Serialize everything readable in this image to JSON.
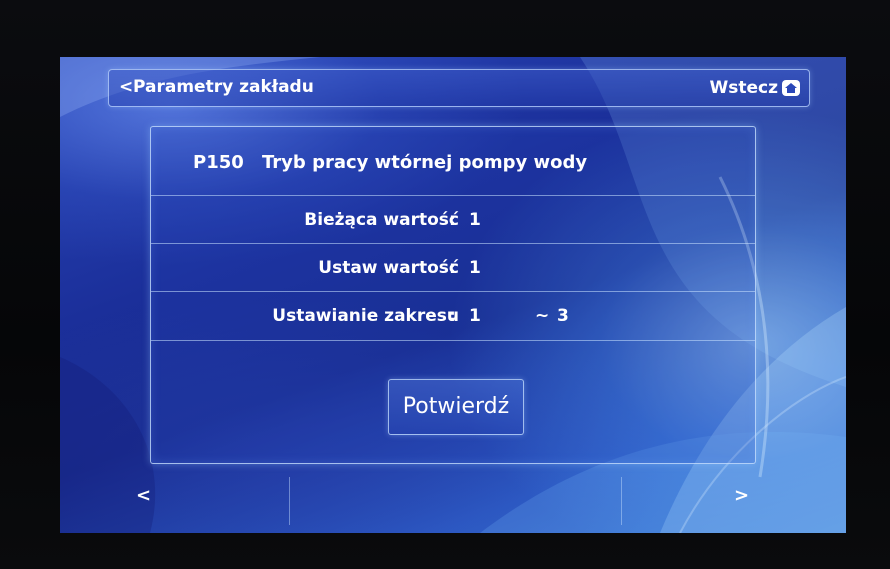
{
  "header": {
    "back_chevron": "<",
    "title": "Parametry zakładu",
    "back_label": "Wstecz",
    "home_icon": "home-icon"
  },
  "parameter": {
    "code": "P150",
    "name": "Tryb pracy wtórnej pompy wody",
    "current_label": "Bieżąca wartość",
    "current_value": "1",
    "set_label": "Ustaw wartość",
    "set_value": "1",
    "range_label": "Ustawianie zakresu",
    "range_min": "1",
    "range_separator": "~",
    "range_max": "3",
    "colon": ":"
  },
  "confirm_label": "Potwierdź",
  "nav": {
    "prev": "<",
    "next": ">"
  },
  "colors": {
    "screen_blue": "#1b2f9a",
    "text": "#ffffff",
    "border": "#c8e1ff"
  }
}
